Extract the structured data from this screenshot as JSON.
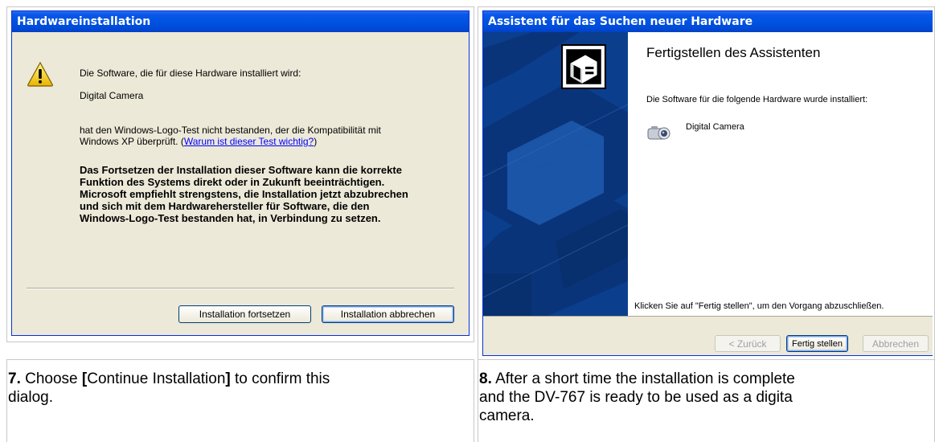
{
  "left_dialog": {
    "title": "Hardwareinstallation",
    "line1": "Die Software, die für diese Hardware installiert wird:",
    "device": "Digital Camera",
    "line3a": "hat den Windows-Logo-Test nicht bestanden, der die Kompatibilität mit",
    "line3b_prefix": "Windows XP überprüft. (",
    "link": "Warum ist dieser Test wichtig?",
    "line3b_suffix": ")",
    "warning_lines": [
      "Das Fortsetzen der Installation dieser Software kann die korrekte",
      "Funktion des Systems direkt oder in Zukunft beeinträchtigen.",
      "Microsoft empfiehlt strengstens, die Installation jetzt abzubrechen",
      "und sich mit dem Hardwarehersteller für Software, die den",
      "Windows-Logo-Test bestanden hat, in Verbindung zu setzen."
    ],
    "btn_continue": "Installation fortsetzen",
    "btn_cancel": "Installation abbrechen",
    "icon": "warning-icon"
  },
  "right_dialog": {
    "title": "Assistent für das Suchen neuer Hardware",
    "heading": "Fertigstellen des Assistenten",
    "line1": "Die Software für die folgende Hardware wurde installiert:",
    "device": "Digital Camera",
    "footer_text": "Klicken Sie auf \"Fertig stellen\", um den Vorgang abzuschließen.",
    "btn_back": "< Zurück",
    "btn_finish": "Fertig stellen",
    "btn_cancel": "Abbrechen",
    "icon": "camera-icon"
  },
  "captions": {
    "left_num": "7.",
    "left_pre": " Choose ",
    "left_bracket_open": "[",
    "left_mid": "Continue Installation",
    "left_bracket_close": "]",
    "left_post": " to confirm this",
    "left_line2": "dialog.",
    "right_num": "8.",
    "right_line1": " After a short time the installation is complete",
    "right_line2": "and the DV-767 is ready to be used as a digita",
    "right_line3": "camera."
  }
}
